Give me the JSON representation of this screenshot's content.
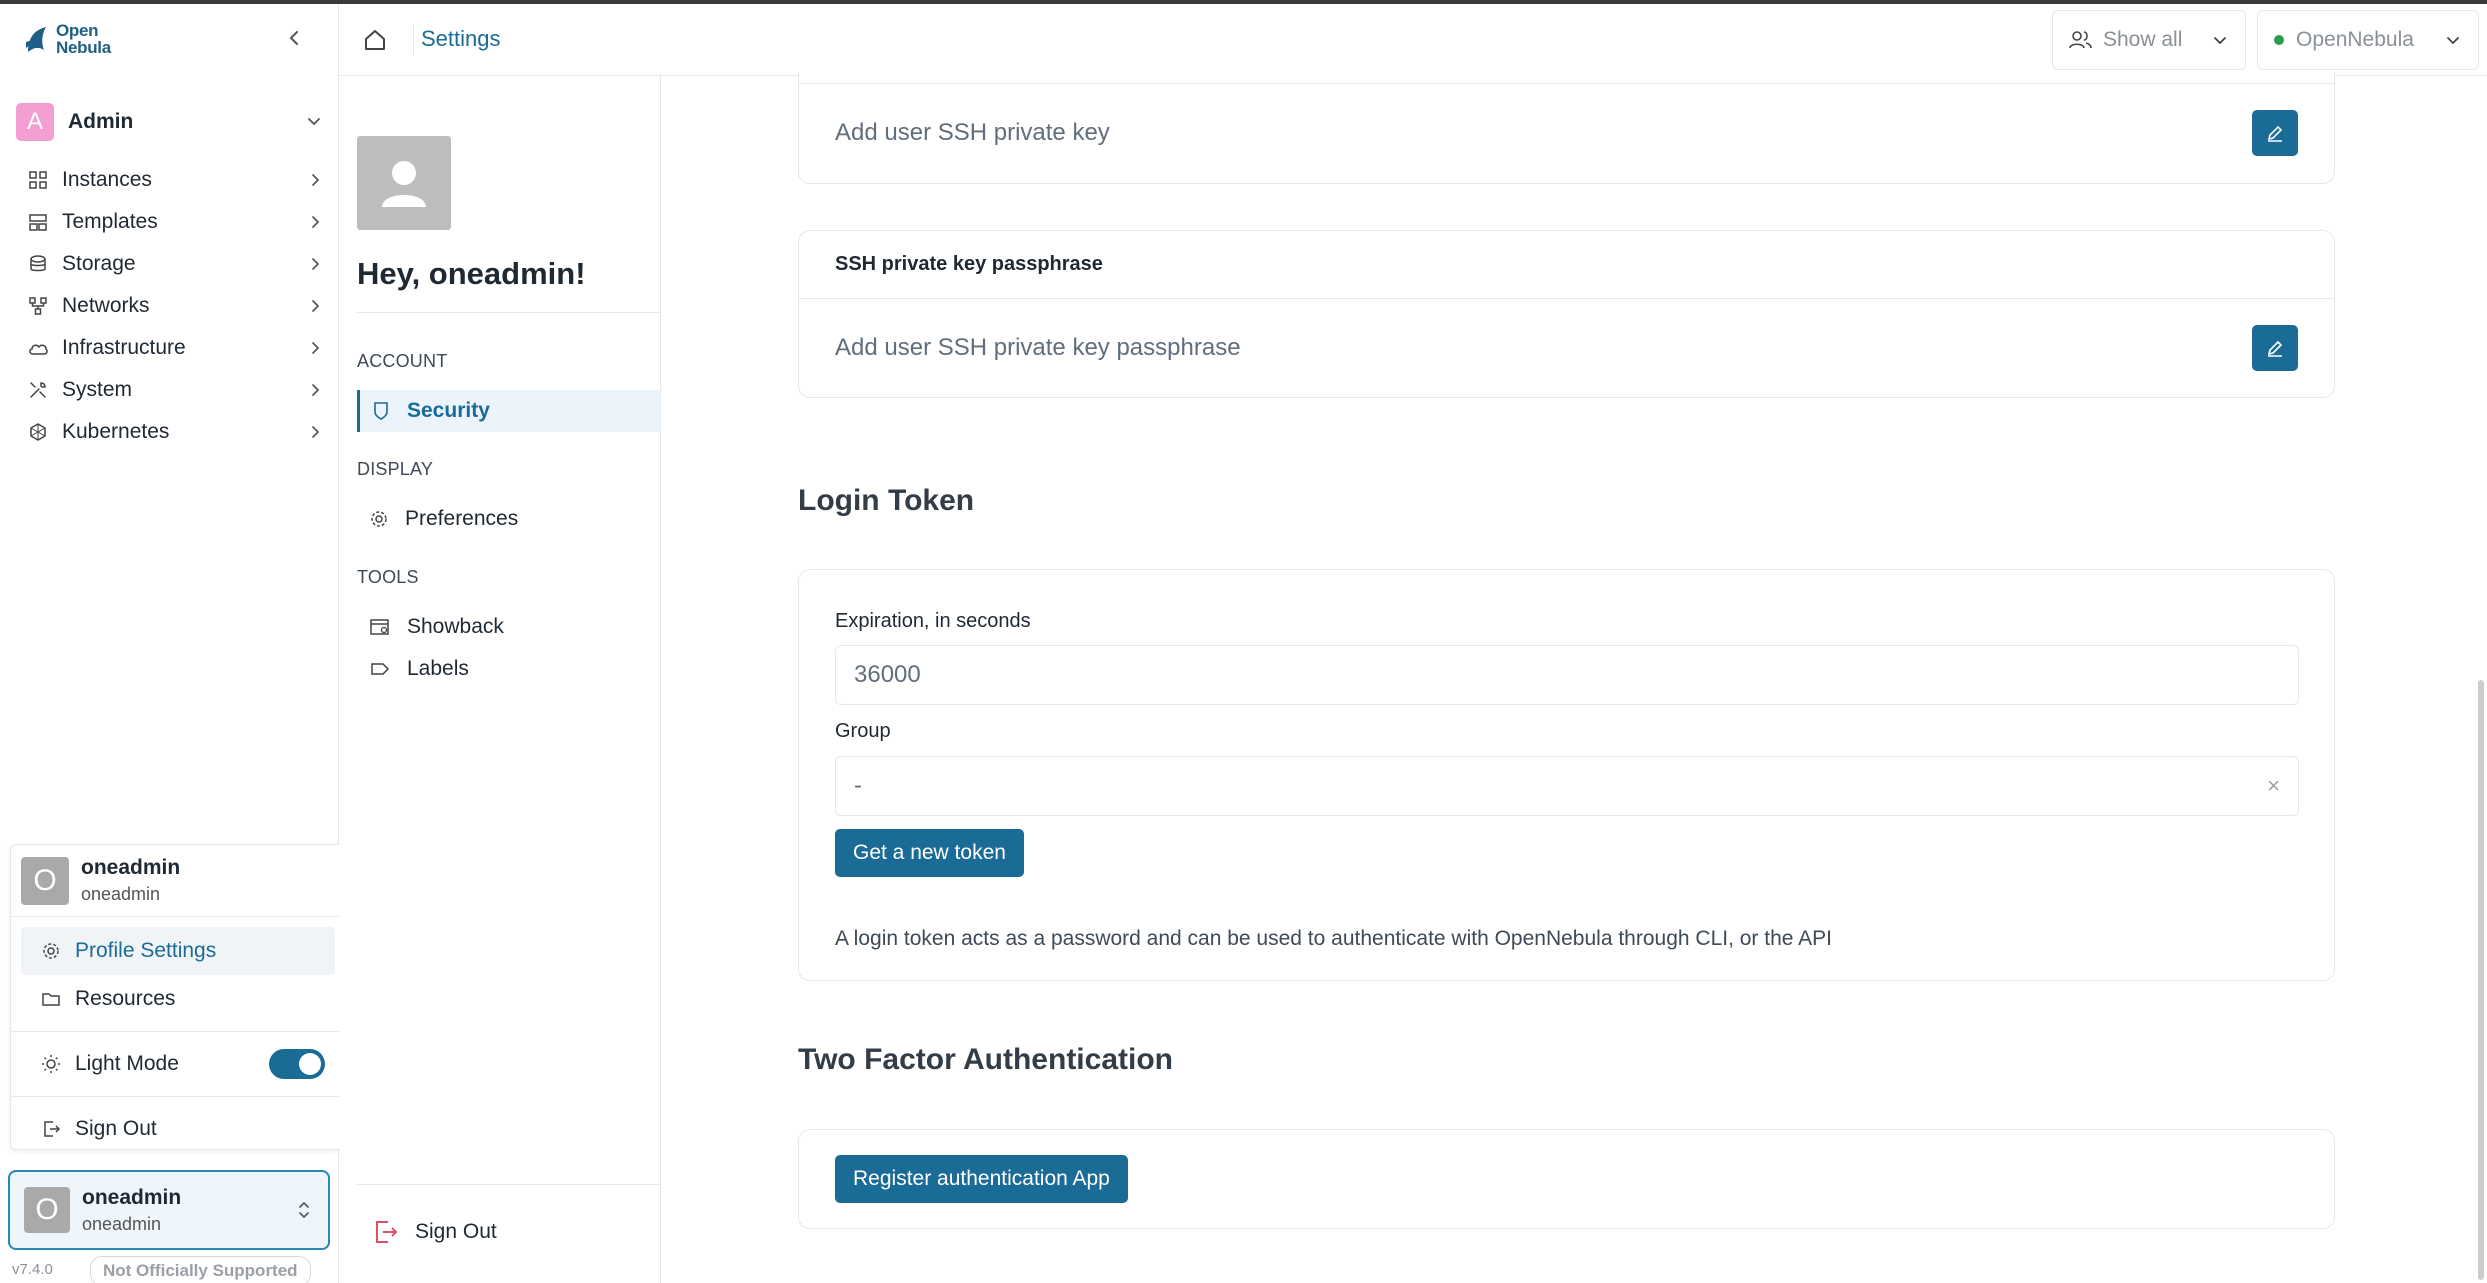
{
  "app": {
    "logo_line1": "Open",
    "logo_line2": "Nebula",
    "brand_color": "#1a6b96"
  },
  "sidebar": {
    "group": {
      "avatar_letter": "A",
      "name": "Admin",
      "avatar_color": "#f29ed0"
    },
    "items": [
      {
        "label": "Instances",
        "icon": "instances-icon"
      },
      {
        "label": "Templates",
        "icon": "templates-icon"
      },
      {
        "label": "Storage",
        "icon": "storage-icon"
      },
      {
        "label": "Networks",
        "icon": "networks-icon"
      },
      {
        "label": "Infrastructure",
        "icon": "cloud-icon"
      },
      {
        "label": "System",
        "icon": "tools-icon"
      },
      {
        "label": "Kubernetes",
        "icon": "kubernetes-icon"
      }
    ],
    "version": "v7.4.0",
    "support_badge": "Not Officially Supported"
  },
  "user_popup": {
    "avatar_letter": "O",
    "name": "oneadmin",
    "subname": "oneadmin",
    "profile_settings": "Profile Settings",
    "resources": "Resources",
    "light_mode": "Light Mode",
    "light_mode_on": true,
    "sign_out": "Sign Out"
  },
  "user_card": {
    "avatar_letter": "O",
    "name": "oneadmin",
    "subname": "oneadmin"
  },
  "topbar": {
    "breadcrumb": "Settings",
    "filter_label": "Show all",
    "zone_label": "OpenNebula",
    "zone_status_color": "#2a9d4a"
  },
  "settings_nav": {
    "greeting": "Hey, oneadmin!",
    "account_section": "ACCOUNT",
    "security": "Security",
    "display_section": "DISPLAY",
    "preferences": "Preferences",
    "tools_section": "TOOLS",
    "showback": "Showback",
    "labels": "Labels",
    "sign_out": "Sign Out"
  },
  "main": {
    "ssh_key_placeholder": "Add user SSH private key",
    "passphrase_title": "SSH private key passphrase",
    "passphrase_placeholder": "Add user SSH private key passphrase",
    "login_token_title": "Login Token",
    "expiration_label": "Expiration, in seconds",
    "expiration_value": "36000",
    "group_label": "Group",
    "group_value": "-",
    "new_token_button": "Get a new token",
    "token_help": "A login token acts as a password and can be used to authenticate with OpenNebula through CLI, or the API",
    "tfa_title": "Two Factor Authentication",
    "register_app_button": "Register authentication App"
  }
}
